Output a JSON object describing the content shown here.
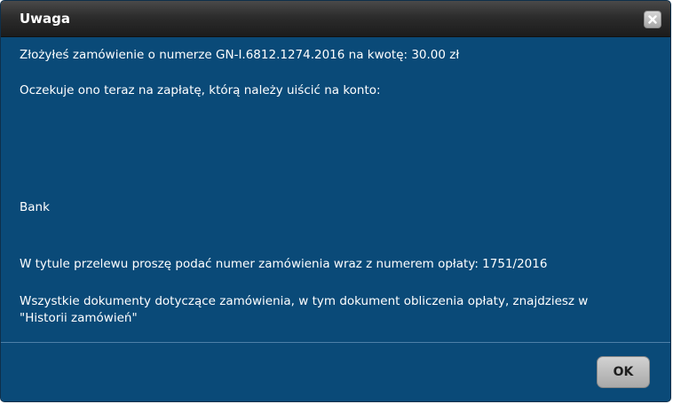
{
  "dialog": {
    "title": "Uwaga",
    "close_icon": "close-icon",
    "messages": {
      "order_info": "Złożyłeś zamówienie o numerze GN-I.6812.1274.2016 na kwotę: 30.00 zł",
      "payment_info": "Oczekuje ono teraz na zapłatę, którą należy uiścić na konto:",
      "bank": "Bank",
      "transfer_title": "W tytule przelewu proszę podać numer zamówienia wraz z numerem opłaty: 1751/2016",
      "documents_info": "Wszystkie dokumenty dotyczące zamówienia, w tym dokument obliczenia opłaty, znajdziesz w \"Historii zamówień\""
    },
    "ok_label": "OK"
  },
  "colors": {
    "dialog_background": "#0a4a78",
    "titlebar": "#2c2c2c",
    "text": "#ffffff",
    "button": "#bdbdbd"
  }
}
